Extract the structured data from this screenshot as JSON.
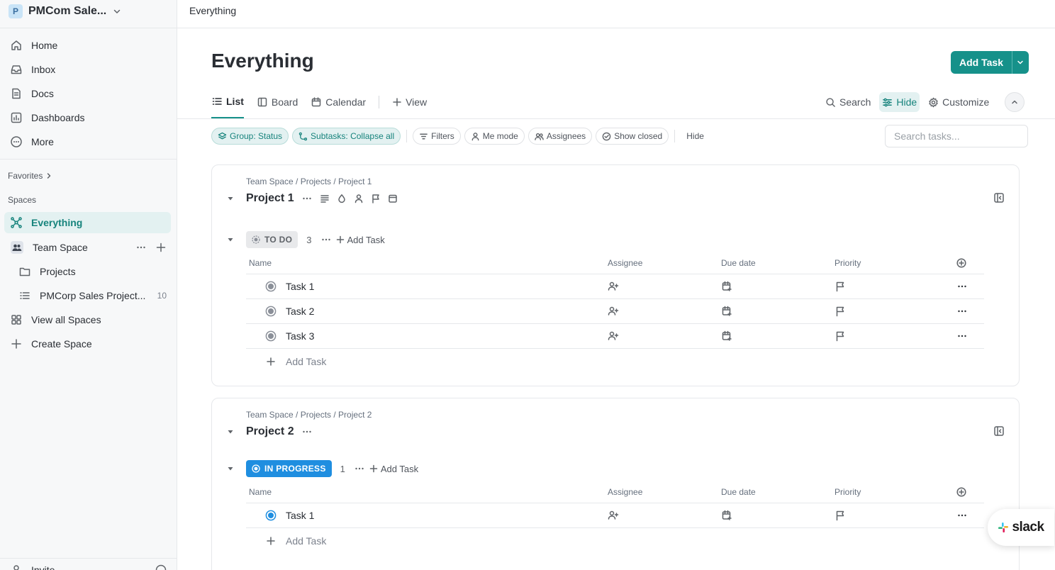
{
  "workspace": {
    "initial": "P",
    "name": "PMCom Sale..."
  },
  "sidebar": {
    "nav": [
      {
        "label": "Home",
        "icon": "home-icon"
      },
      {
        "label": "Inbox",
        "icon": "inbox-icon"
      },
      {
        "label": "Docs",
        "icon": "docs-icon"
      },
      {
        "label": "Dashboards",
        "icon": "dashboards-icon"
      },
      {
        "label": "More",
        "icon": "more-icon"
      }
    ],
    "favorites_label": "Favorites",
    "spaces_label": "Spaces",
    "spaces": {
      "everything": "Everything",
      "team_space": "Team Space",
      "projects": "Projects",
      "pmcorp": "PMCorp Sales Project...",
      "pmcorp_count": "10",
      "view_all": "View all Spaces",
      "create": "Create Space"
    },
    "invite": "Invite"
  },
  "header": {
    "breadcrumb": "Everything",
    "title": "Everything",
    "add_task": "Add Task"
  },
  "views": {
    "tabs": [
      "List",
      "Board",
      "Calendar"
    ],
    "add_view": "View",
    "search": "Search",
    "hide": "Hide",
    "customize": "Customize"
  },
  "filters": {
    "group": "Group: Status",
    "subtasks": "Subtasks: Collapse all",
    "filters": "Filters",
    "me_mode": "Me mode",
    "assignees": "Assignees",
    "show_closed": "Show closed",
    "hide": "Hide",
    "search_placeholder": "Search tasks..."
  },
  "columns": {
    "name": "Name",
    "assignee": "Assignee",
    "due": "Due date",
    "priority": "Priority"
  },
  "projects": [
    {
      "crumb": "Team Space / Projects / Project 1",
      "name": "Project 1",
      "status": "TO DO",
      "count": "3",
      "add_task": "Add Task",
      "tasks": [
        "Task 1",
        "Task 2",
        "Task 3"
      ],
      "add_row": "Add Task"
    },
    {
      "crumb": "Team Space / Projects / Project 2",
      "name": "Project 2",
      "status": "IN PROGRESS",
      "count": "1",
      "add_task": "Add Task",
      "tasks": [
        "Task 1"
      ],
      "add_row": "Add Task"
    }
  ],
  "slack": "slack",
  "colors": {
    "accent": "#16918a",
    "in_progress": "#1f8ee0",
    "todo": "#8a8f98"
  }
}
